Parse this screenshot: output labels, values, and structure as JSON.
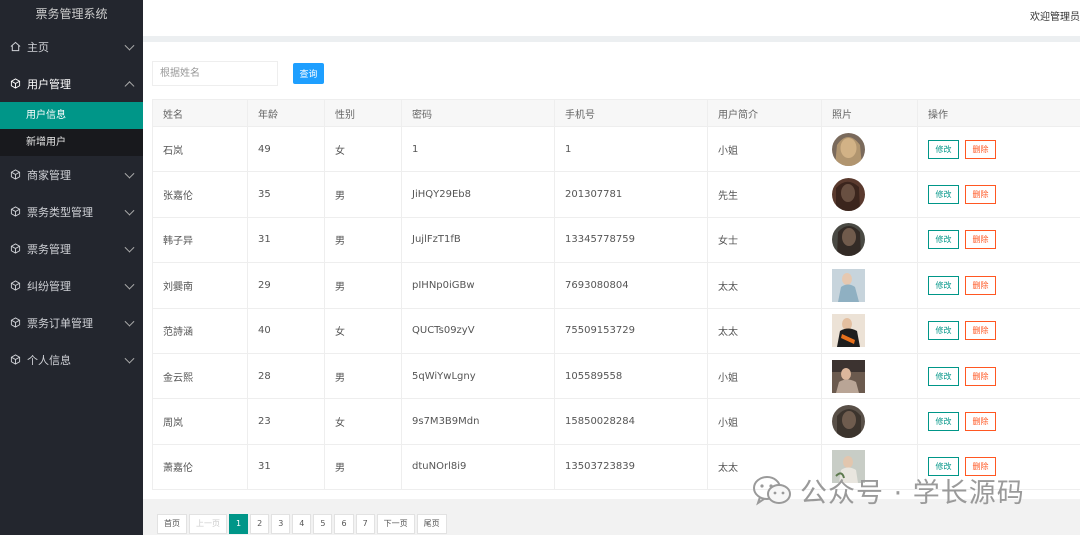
{
  "app": {
    "title": "票务管理系统",
    "welcome": "欢迎管理员"
  },
  "sidebar": {
    "items": [
      {
        "label": "主页",
        "icon": "home-icon",
        "expanded": false
      },
      {
        "label": "用户管理",
        "icon": "box-icon",
        "expanded": true,
        "children": [
          "用户信息",
          "新增用户"
        ]
      },
      {
        "label": "商家管理",
        "icon": "box-icon",
        "expanded": false
      },
      {
        "label": "票务类型管理",
        "icon": "box-icon",
        "expanded": false
      },
      {
        "label": "票务管理",
        "icon": "box-icon",
        "expanded": false
      },
      {
        "label": "纠纷管理",
        "icon": "box-icon",
        "expanded": false
      },
      {
        "label": "票务订单管理",
        "icon": "box-icon",
        "expanded": false
      },
      {
        "label": "个人信息",
        "icon": "box-icon",
        "expanded": false
      }
    ]
  },
  "search": {
    "placeholder": "根据姓名",
    "button": "查询"
  },
  "table": {
    "headers": [
      "姓名",
      "年龄",
      "性别",
      "密码",
      "手机号",
      "用户简介",
      "照片",
      "操作"
    ],
    "edit_label": "修改",
    "delete_label": "删除",
    "rows": [
      [
        "石岚",
        "49",
        "女",
        "1",
        "1",
        "小姐"
      ],
      [
        "张嘉伦",
        "35",
        "男",
        "JiHQY29Eb8",
        "201307781",
        "先生"
      ],
      [
        "韩子异",
        "31",
        "男",
        "JujlFzT1fB",
        "13345778759",
        "女士"
      ],
      [
        "刘爨南",
        "29",
        "男",
        "pIHNp0iGBw",
        "7693080804",
        "太太"
      ],
      [
        "范詩涵",
        "40",
        "女",
        "QUCTs09zyV",
        "75509153729",
        "太太"
      ],
      [
        "金云熙",
        "28",
        "男",
        "5qWiYwLgny",
        "105589558",
        "小姐"
      ],
      [
        "周岚",
        "23",
        "女",
        "9s7M3B9Mdn",
        "15850028284",
        "小姐"
      ],
      [
        "萧嘉伦",
        "31",
        "男",
        "dtuNOrl8i9",
        "13503723839",
        "太太"
      ]
    ]
  },
  "pagination": {
    "first": "首页",
    "prev": "上一页",
    "pages": [
      "1",
      "2",
      "3",
      "4",
      "5",
      "6",
      "7"
    ],
    "current": "1",
    "next": "下一页",
    "last": "尾页"
  },
  "watermark": "公众号 · 学长源码",
  "colors": {
    "sidebar_bg": "#23262e",
    "accent": "#009688",
    "search_btn": "#1e9fff",
    "delete": "#ff5722"
  }
}
